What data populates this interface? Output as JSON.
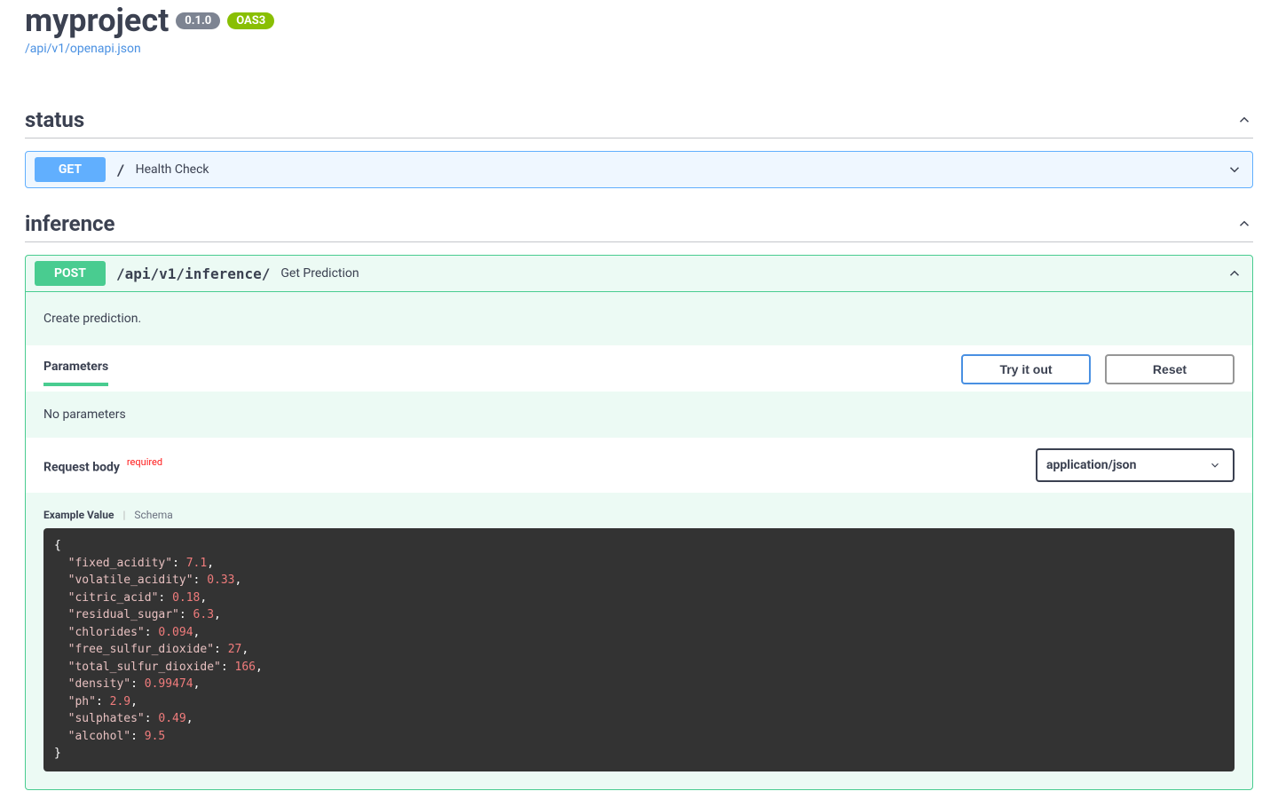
{
  "header": {
    "title": "myproject",
    "version": "0.1.0",
    "oas_badge": "OAS3",
    "spec_link": "/api/v1/openapi.json"
  },
  "sections": {
    "status": {
      "title": "status",
      "ops": {
        "get": {
          "method": "GET",
          "path": "/",
          "summary": "Health Check"
        }
      }
    },
    "inference": {
      "title": "inference",
      "ops": {
        "post": {
          "method": "POST",
          "path": "/api/v1/inference/",
          "summary": "Get Prediction",
          "description": "Create prediction.",
          "parameters_tab": "Parameters",
          "try_label": "Try it out",
          "reset_label": "Reset",
          "no_params": "No parameters",
          "request_body_label": "Request body",
          "required_label": "required",
          "content_type": "application/json",
          "example_tab": "Example Value",
          "schema_tab": "Schema",
          "example": {
            "fixed_acidity": 7.1,
            "volatile_acidity": 0.33,
            "citric_acid": 0.18,
            "residual_sugar": 6.3,
            "chlorides": 0.094,
            "free_sulfur_dioxide": 27,
            "total_sulfur_dioxide": 166,
            "density": 0.99474,
            "ph": 2.9,
            "sulphates": 0.49,
            "alcohol": 9.5
          }
        }
      }
    }
  }
}
